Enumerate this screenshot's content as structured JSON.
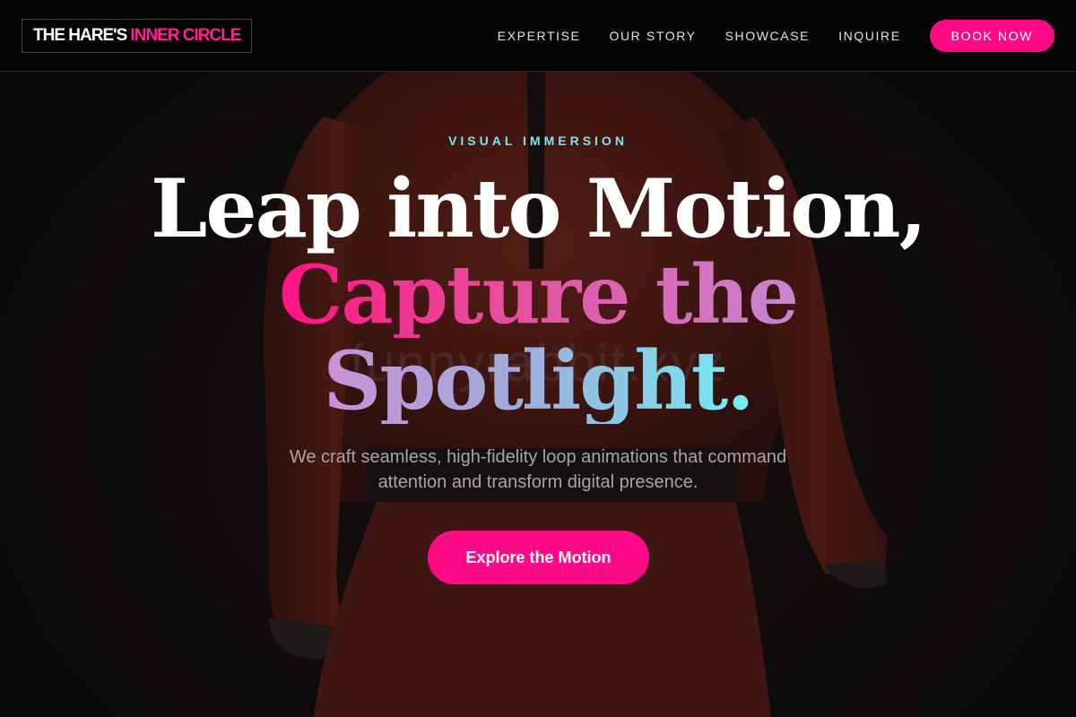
{
  "nav": {
    "logo_white": "THE HARE'S",
    "logo_accent": "INNER CIRCLE",
    "links": [
      "EXPERTISE",
      "OUR STORY",
      "SHOWCASE",
      "INQUIRE"
    ],
    "cta_label": "BOOK NOW"
  },
  "hero": {
    "eyebrow": "VISUAL IMMERSION",
    "headline_line1": "Leap into Motion,",
    "headline_line2": "Capture the",
    "headline_line3": "Spotlight.",
    "watermark": "funnyrabbit.xyz",
    "subtitle": "We craft seamless, high-fidelity loop animations that command attention and transform digital presence.",
    "cta_label": "Explore the Motion"
  },
  "colors": {
    "accent_pink": "#ff0a86",
    "accent_cyan": "#7fe3ee",
    "nav_bg": "#050404"
  }
}
